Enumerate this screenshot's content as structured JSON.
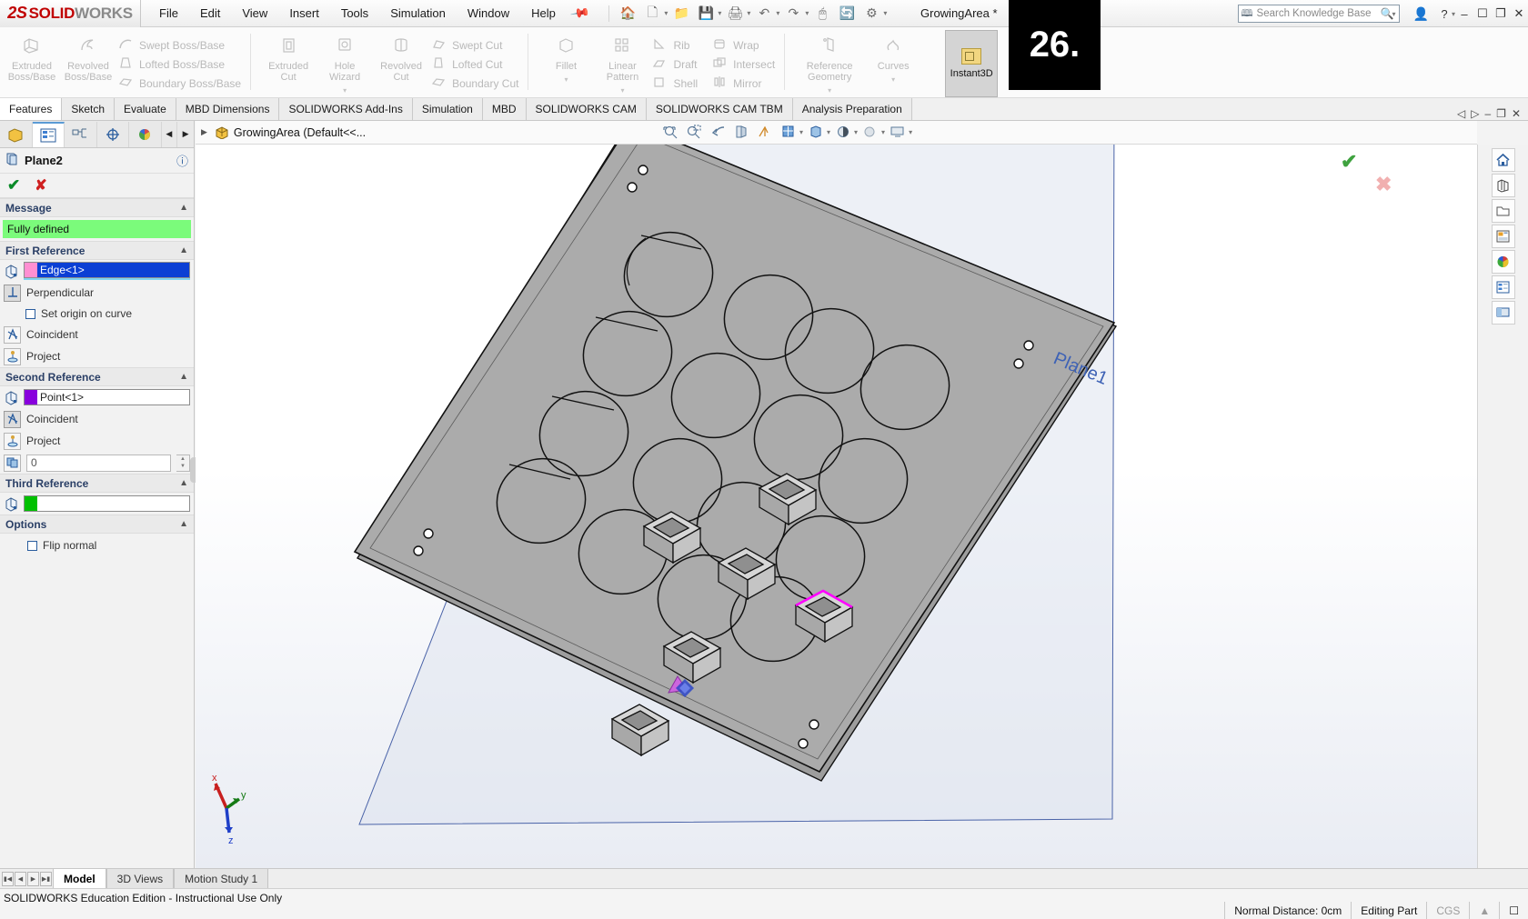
{
  "app": {
    "brand_ds": "2S",
    "brand_solid": "SOLID",
    "brand_works": "WORKS",
    "document_title": "GrowingArea *",
    "overlay_number": "26."
  },
  "menubar": [
    "File",
    "Edit",
    "View",
    "Insert",
    "Tools",
    "Simulation",
    "Window",
    "Help"
  ],
  "search": {
    "placeholder": "Search Knowledge Base"
  },
  "ribbon": {
    "groups": [
      {
        "big": [
          {
            "label": "Extruded\nBoss/Base",
            "icon": "extruded-boss-icon"
          },
          {
            "label": "Revolved\nBoss/Base",
            "icon": "revolved-boss-icon"
          }
        ],
        "small": [
          {
            "label": "Swept Boss/Base",
            "icon": "swept-boss-icon"
          },
          {
            "label": "Lofted Boss/Base",
            "icon": "lofted-boss-icon"
          },
          {
            "label": "Boundary Boss/Base",
            "icon": "boundary-boss-icon"
          }
        ]
      },
      {
        "big": [
          {
            "label": "Extruded\nCut",
            "icon": "extruded-cut-icon"
          },
          {
            "label": "Hole\nWizard",
            "icon": "hole-wizard-icon"
          },
          {
            "label": "Revolved\nCut",
            "icon": "revolved-cut-icon"
          }
        ],
        "small": [
          {
            "label": "Swept Cut",
            "icon": "swept-cut-icon"
          },
          {
            "label": "Lofted Cut",
            "icon": "lofted-cut-icon"
          },
          {
            "label": "Boundary Cut",
            "icon": "boundary-cut-icon"
          }
        ]
      },
      {
        "big": [
          {
            "label": "Fillet",
            "icon": "fillet-icon"
          },
          {
            "label": "Linear\nPattern",
            "icon": "linear-pattern-icon"
          }
        ],
        "small": [
          {
            "label": "Rib",
            "icon": "rib-icon"
          },
          {
            "label": "Draft",
            "icon": "draft-icon"
          },
          {
            "label": "Shell",
            "icon": "shell-icon"
          }
        ],
        "small2": [
          {
            "label": "Wrap",
            "icon": "wrap-icon"
          },
          {
            "label": "Intersect",
            "icon": "intersect-icon"
          },
          {
            "label": "Mirror",
            "icon": "mirror-icon"
          }
        ]
      },
      {
        "big": [
          {
            "label": "Reference\nGeometry",
            "icon": "reference-geometry-icon"
          },
          {
            "label": "Curves",
            "icon": "curves-icon"
          }
        ]
      }
    ],
    "instant3d": "Instant3D"
  },
  "command_tabs": [
    {
      "label": "Features",
      "active": true
    },
    {
      "label": "Sketch",
      "active": false
    },
    {
      "label": "Evaluate",
      "active": false
    },
    {
      "label": "MBD Dimensions",
      "active": false
    },
    {
      "label": "SOLIDWORKS Add-Ins",
      "active": false
    },
    {
      "label": "Simulation",
      "active": false
    },
    {
      "label": "MBD",
      "active": false
    },
    {
      "label": "SOLIDWORKS CAM",
      "active": false
    },
    {
      "label": "SOLIDWORKS CAM TBM",
      "active": false
    },
    {
      "label": "Analysis Preparation",
      "active": false
    }
  ],
  "property_manager": {
    "tabs": [
      "feature-tree-tab",
      "property-manager-tab",
      "configuration-tab",
      "dim-xpert-tab",
      "display-manager-tab"
    ],
    "title": "Plane2",
    "help": "?",
    "accept": "✔",
    "reject": "✘",
    "message_header": "Message",
    "message_value": "Fully defined",
    "first_reference": {
      "header": "First Reference",
      "value": "Edge<1>",
      "swatch": "#ff8fd2",
      "constraints": [
        {
          "label": "Perpendicular",
          "icon": "perpendicular-icon",
          "pressed": true
        },
        {
          "label": "Coincident",
          "icon": "coincident-icon",
          "pressed": false
        },
        {
          "label": "Project",
          "icon": "project-icon",
          "pressed": false
        }
      ],
      "checkbox_label": "Set origin on curve",
      "checkbox_checked": false
    },
    "second_reference": {
      "header": "Second Reference",
      "value": "Point<1>",
      "swatch": "#8800dd",
      "constraints": [
        {
          "label": "Coincident",
          "icon": "coincident-icon",
          "pressed": true
        },
        {
          "label": "Project",
          "icon": "project-icon",
          "pressed": false
        }
      ],
      "numeric_value": "0",
      "numeric_icon": "offset-distance-icon"
    },
    "third_reference": {
      "header": "Third Reference",
      "value": "",
      "swatch": "#00c000"
    },
    "options": {
      "header": "Options",
      "flip_normal_label": "Flip normal",
      "flip_normal_checked": false
    }
  },
  "feature_tree": {
    "root": "GrowingArea  (Default<<...",
    "expand_arrow": "▶"
  },
  "graphics": {
    "plane_label": "Plane1",
    "plane_label_color": "#3e62b5",
    "part_face_color": "#ababab",
    "plane_fill": "#dfe3ef",
    "hole_rows": [
      3,
      4,
      4,
      4,
      3
    ],
    "cube_count": 6,
    "highlight_cube_color": "#ff00ff",
    "origin_marker_color": "#2d46c8",
    "triad_x": "x",
    "triad_y": "y",
    "triad_z": "z"
  },
  "view_toolbar": [
    "zoom-to-fit-icon",
    "zoom-to-area-icon",
    "previous-view-icon",
    "section-view-icon",
    "view-orientation-icon",
    "display-style-icon",
    "hide-show-icon",
    "edit-appearance-icon",
    "apply-scene-icon",
    "view-settings-icon"
  ],
  "right_toolbar": [
    "home-icon",
    "view-palette-icon",
    "open-folder-icon",
    "appearances-icon",
    "colors-icon",
    "custom-properties-icon",
    "display-pane-icon"
  ],
  "bottom_tabs": [
    {
      "label": "Model",
      "active": true
    },
    {
      "label": "3D Views",
      "active": false
    },
    {
      "label": "Motion Study 1",
      "active": false
    }
  ],
  "status_bar": {
    "education_notice": "SOLIDWORKS Education Edition - Instructional Use Only",
    "normal_distance": "Normal Distance: 0cm",
    "edit_mode": "Editing Part",
    "units": "CGS"
  }
}
